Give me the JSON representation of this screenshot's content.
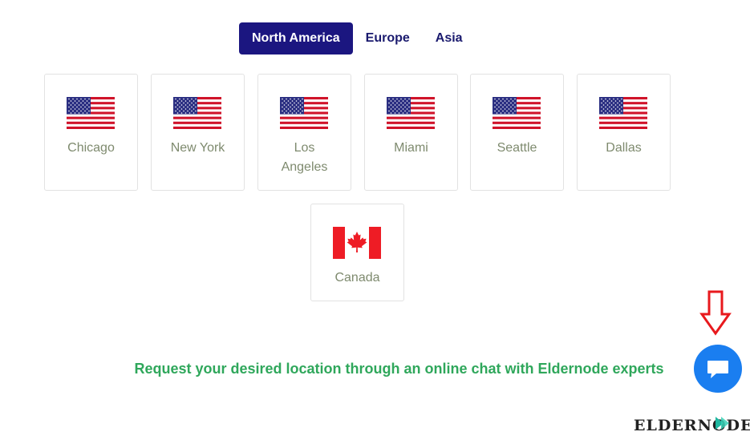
{
  "tabs": [
    {
      "label": "North America",
      "active": true
    },
    {
      "label": "Europe",
      "active": false
    },
    {
      "label": "Asia",
      "active": false
    }
  ],
  "locations": [
    {
      "city": "Chicago",
      "flag": "us-flag-icon"
    },
    {
      "city": "New York",
      "flag": "us-flag-icon"
    },
    {
      "city": "Los Angeles",
      "flag": "us-flag-icon"
    },
    {
      "city": "Miami",
      "flag": "us-flag-icon"
    },
    {
      "city": "Seattle",
      "flag": "us-flag-icon"
    },
    {
      "city": "Dallas",
      "flag": "us-flag-icon"
    },
    {
      "city": "Canada",
      "flag": "canada-flag-icon"
    }
  ],
  "cta": {
    "text": "Request your desired location through an online chat with Eldernode experts"
  },
  "chat": {
    "icon": "chat-bubble-icon"
  },
  "logo": {
    "text": "eldernode"
  },
  "colors": {
    "active_tab": "#1b1680",
    "tab_text": "#1a1a6e",
    "city_text": "#7e8a6e",
    "cta_text": "#2fa75b",
    "chat_button": "#1a7ef0",
    "arrow": "#e8191d"
  }
}
